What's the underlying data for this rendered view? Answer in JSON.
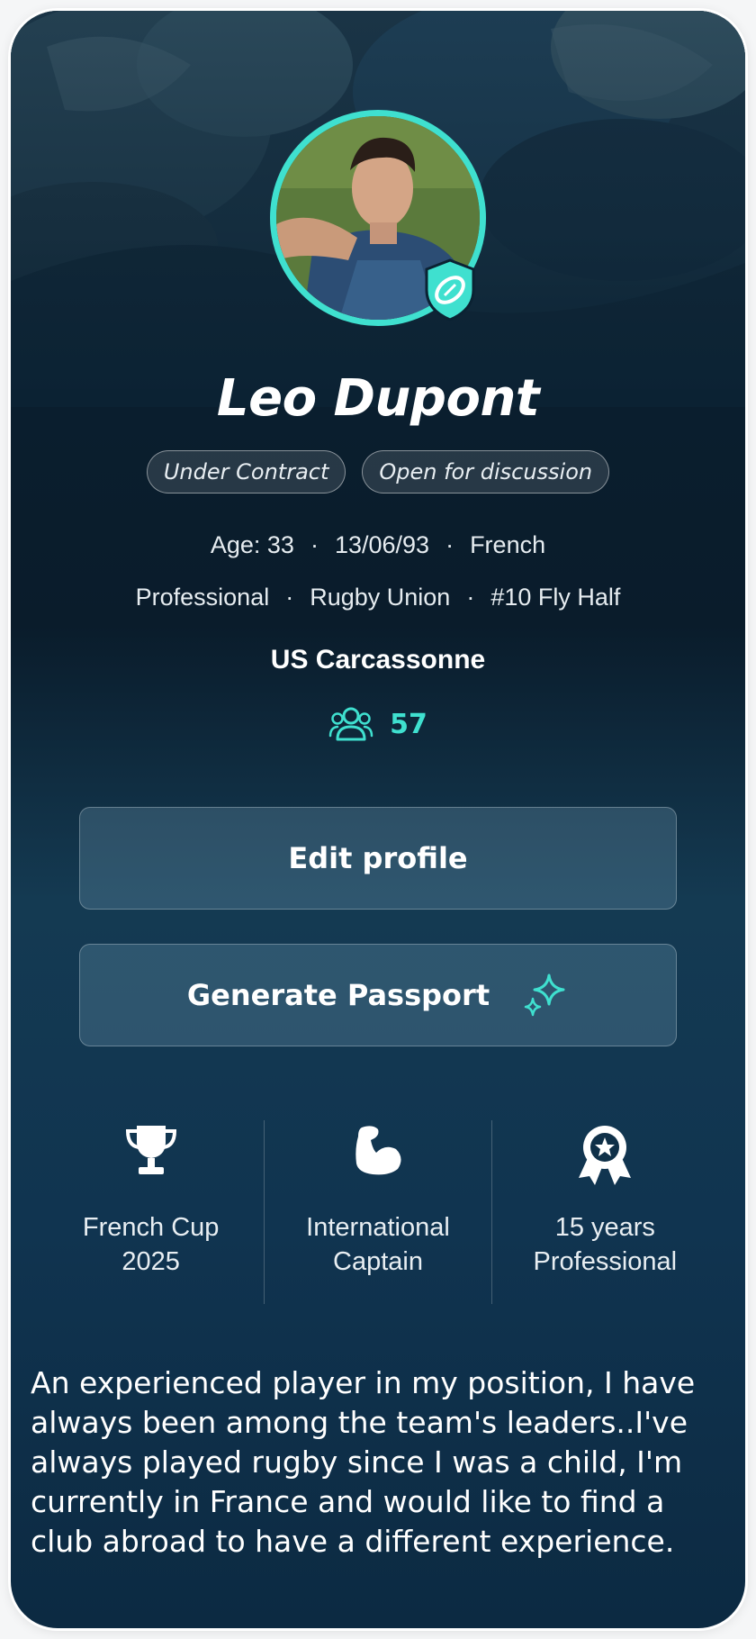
{
  "profile": {
    "name": "Leo Dupont",
    "chips": [
      "Under Contract",
      "Open for discussion"
    ],
    "age": "Age: 33",
    "dob": "13/06/93",
    "nationality": "French",
    "level": "Professional",
    "sport": "Rugby Union",
    "position": "#10 Fly Half",
    "club": "US Carcassonne",
    "followers": "57"
  },
  "actions": {
    "edit_label": "Edit profile",
    "passport_label": "Generate Passport"
  },
  "stats": [
    {
      "icon": "trophy-icon",
      "line1": "French Cup",
      "line2": "2025"
    },
    {
      "icon": "flexed-arm-icon",
      "line1": "International",
      "line2": "Captain"
    },
    {
      "icon": "award-ribbon-icon",
      "line1": "15 years",
      "line2": "Professional"
    }
  ],
  "bio": "An experienced player in my position, I have always been among the team's leaders..I've always played rugby since I was a child, I'm currently in France and would like to find a club abroad to have a different experience.",
  "colors": {
    "accent": "#3fe0cf",
    "background_top": "#0b2233",
    "background_bottom": "#0c2a42"
  }
}
